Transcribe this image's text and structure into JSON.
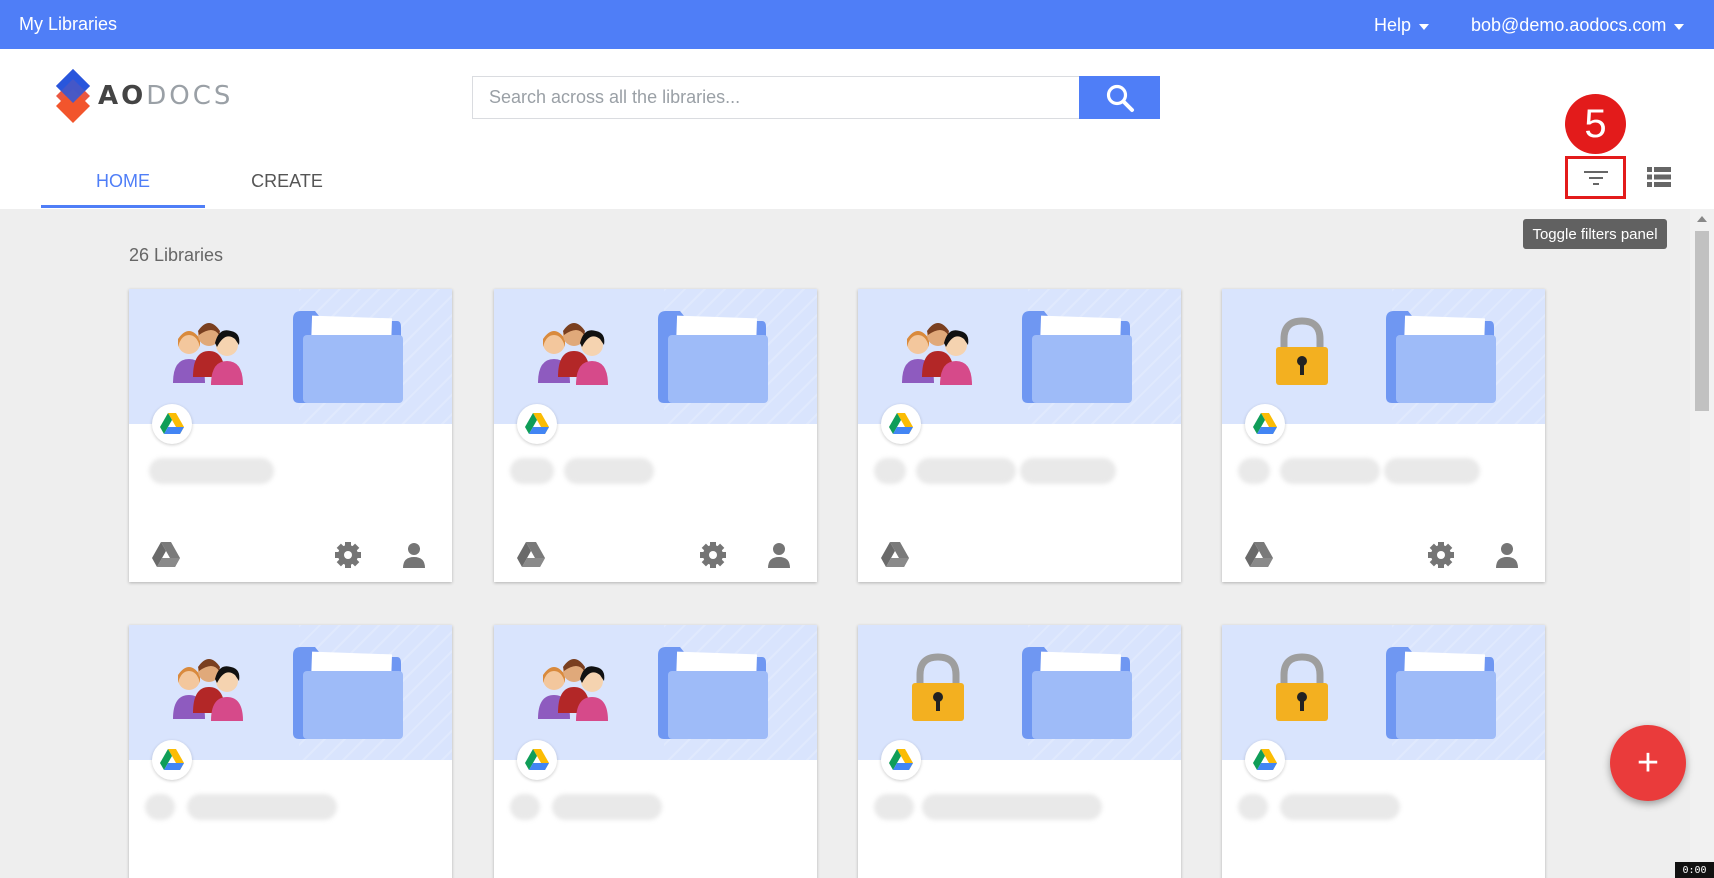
{
  "topbar": {
    "title": "My Libraries",
    "help_label": "Help",
    "user_email": "bob@demo.aodocs.com"
  },
  "logo": {
    "text_dark": "AO",
    "text_light": "DOCS"
  },
  "search": {
    "placeholder": "Search across all the libraries...",
    "icon": "search-icon"
  },
  "tabs": [
    {
      "label": "HOME",
      "active": true
    },
    {
      "label": "CREATE",
      "active": false
    }
  ],
  "annotation": {
    "step": "5"
  },
  "tooltip": "Toggle filters panel",
  "library_count": "26 Libraries",
  "cards": [
    {
      "art": "people",
      "settings": true
    },
    {
      "art": "people",
      "settings": true
    },
    {
      "art": "people",
      "settings": false
    },
    {
      "art": "lock",
      "settings": true
    },
    {
      "art": "people",
      "settings": true
    },
    {
      "art": "people",
      "settings": true
    },
    {
      "art": "lock",
      "settings": true
    },
    {
      "art": "lock",
      "settings": true
    }
  ],
  "fab": "+",
  "timer": "0:00",
  "colors": {
    "brand": "#4f7ef7",
    "annotation": "#e31b1b",
    "fab": "#ea3b3b",
    "banner": "#d9e4fd"
  }
}
